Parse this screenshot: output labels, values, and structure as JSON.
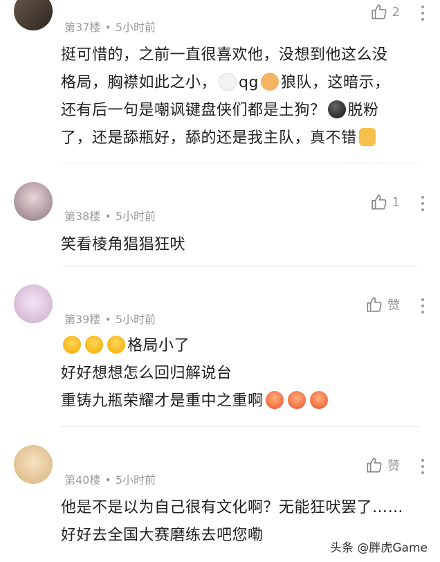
{
  "comments": [
    {
      "floor": "第37楼",
      "time": "5小时前",
      "likes": "2",
      "lines": [
        "挺可惜的，之前一直很喜欢他，没想到他这么没",
        "格局，胸襟如此之小，",
        "还有后一句是嘲讽键盘侠们都是土狗？",
        "了，还是舔瓶好，舔的还是我主队，真不错"
      ],
      "inline_text": {
        "qg": "qg",
        "wolf": "狼队，这暗示，",
        "fen": "脱粉"
      }
    },
    {
      "floor": "第38楼",
      "time": "5小时前",
      "likes": "1",
      "lines": [
        "笑看棱角猖猖狂吠"
      ]
    },
    {
      "floor": "第39楼",
      "time": "5小时前",
      "likes": "赞",
      "lines": [
        "格局小了",
        "好好想想怎么回归解说台",
        "重铸九瓶荣耀才是重中之重啊"
      ]
    },
    {
      "floor": "第40楼",
      "time": "5小时前",
      "likes": "赞",
      "lines": [
        "他是不是以为自己很有文化啊？无能狂吠罢了……",
        "好好去全国大赛磨练去吧您嘞"
      ]
    }
  ],
  "dot_separator": "•",
  "watermark": "头条 @胖虎Game",
  "icons": {
    "like": "thumbs-up-icon",
    "more": "more-vertical-icon"
  }
}
